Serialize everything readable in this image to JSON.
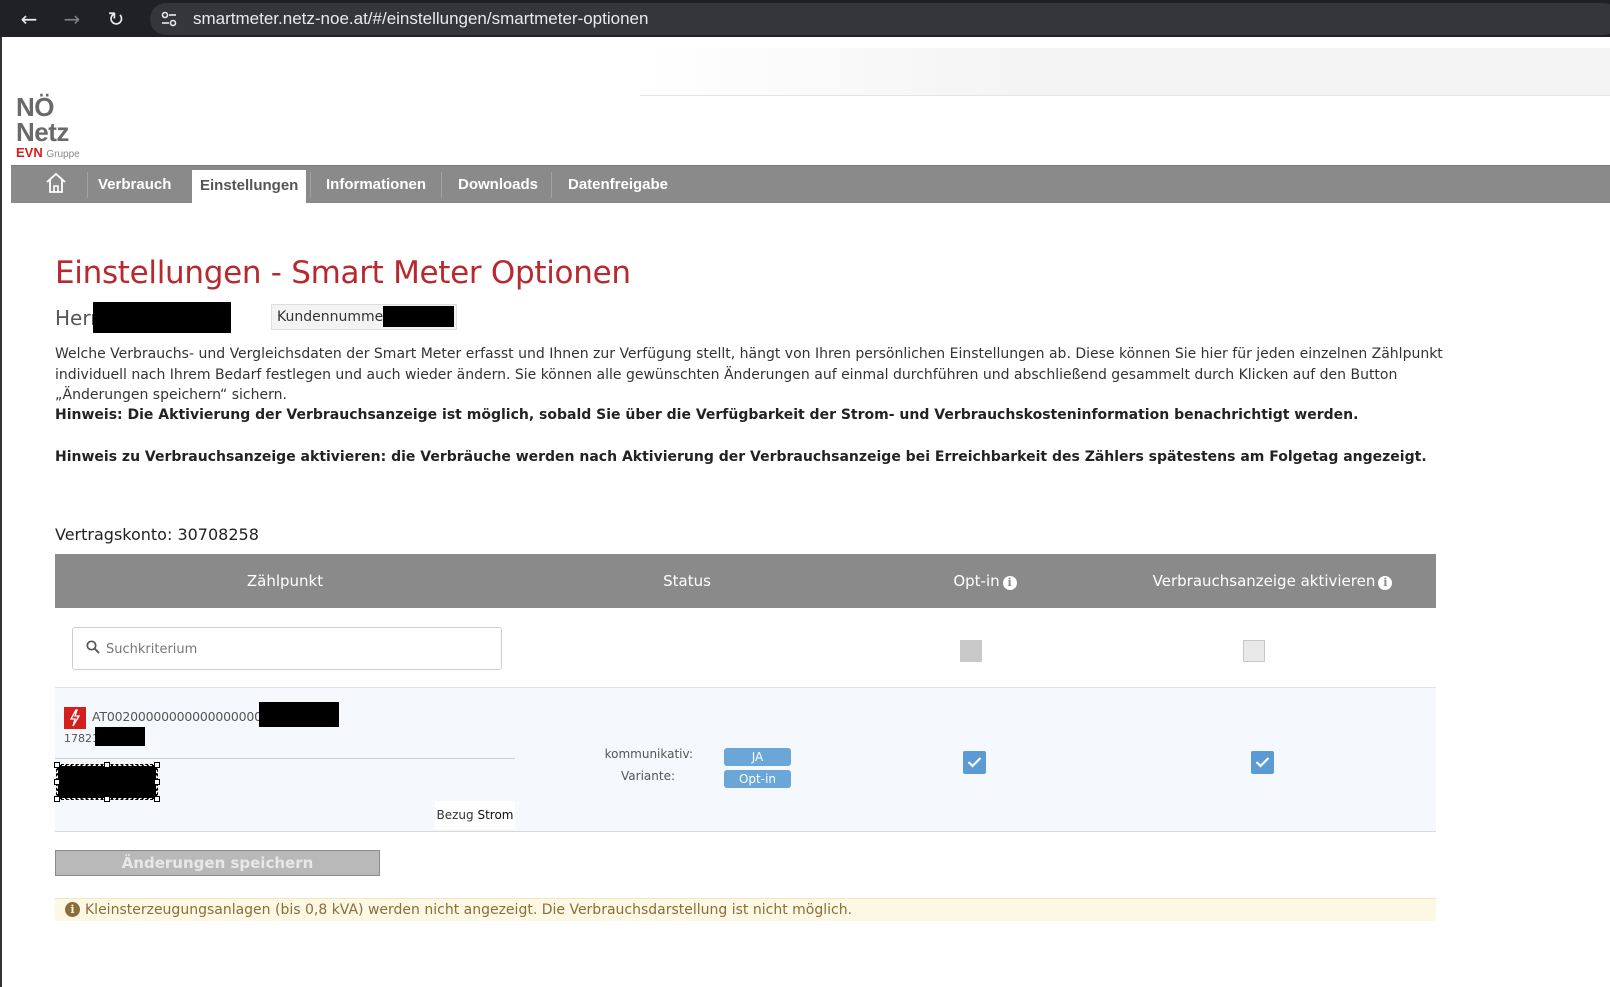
{
  "browser": {
    "url": "smartmeter.netz-noe.at/#/einstellungen/smartmeter-optionen",
    "back_glyph": "←",
    "forward_glyph": "→",
    "reload_glyph": "↻"
  },
  "logo": {
    "line1": "NÖ",
    "line2": "Netz",
    "evn": "EVN",
    "gruppe": "Gruppe"
  },
  "menu": {
    "items": [
      {
        "label": "Verbrauch"
      },
      {
        "label": "Einstellungen",
        "active": true
      },
      {
        "label": "Informationen"
      },
      {
        "label": "Downloads"
      },
      {
        "label": "Datenfreigabe"
      }
    ]
  },
  "page": {
    "title": "Einstellungen - Smart Meter Optionen",
    "salutation": "Herr",
    "kundennummer_label": "Kundennummer:",
    "intro": "Welche Verbrauchs- und Vergleichsdaten der Smart Meter erfasst und Ihnen zur Verfügung stellt, hängt von Ihren persönlichen Einstellungen ab. Diese können Sie hier für jeden einzelnen Zählpunkt individuell nach Ihrem Bedarf festlegen und auch wieder ändern. Sie können alle gewünschten Änderungen auf einmal durchführen und abschließend gesammelt durch Klicken auf den Button „Änderungen speichern“ sichern.",
    "hint1": "Hinweis: Die Aktivierung der Verbrauchsanzeige ist möglich, sobald Sie über die Verfügbarkeit der Strom- und Verbrauchskosteninformation benachrichtigt werden.",
    "hint2": "Hinweis zu Verbrauchsanzeige aktivieren: die Verbräuche werden nach Aktivierung der Verbrauchsanzeige bei Erreichbarkeit des Zählers spätestens am Folgetag angezeigt.",
    "account_label": "Vertragskonto: 30708258"
  },
  "table": {
    "headers": {
      "zaehlpunkt": "Zählpunkt",
      "status": "Status",
      "optin": "Opt-in",
      "verbrauchsanzeige": "Verbrauchsanzeige aktivieren"
    },
    "search_placeholder": "Suchkriterium",
    "row": {
      "meter_id": "AT0020000000000000000000",
      "meter_sub": "17821",
      "bezug_prefix": "Bezug",
      "bezug_type": "Strom",
      "kommunikativ_label": "kommunikativ:",
      "kommunikativ_value": "JA",
      "variante_label": "Variante:",
      "variante_value": "Opt-in",
      "optin_checked": true,
      "verbrauchsanzeige_checked": true
    }
  },
  "save_button": "Änderungen speichern",
  "notice": "Kleinsterzeugungsanlagen (bis 0,8 kVA) werden nicht angezeigt. Die Verbrauchsdarstellung ist nicht möglich.",
  "colors": {
    "accent_red": "#b8292f",
    "menu_grey": "#8a8a8a",
    "checkbox_blue": "#5b9bd5",
    "badge_blue": "#6aa6d8"
  }
}
